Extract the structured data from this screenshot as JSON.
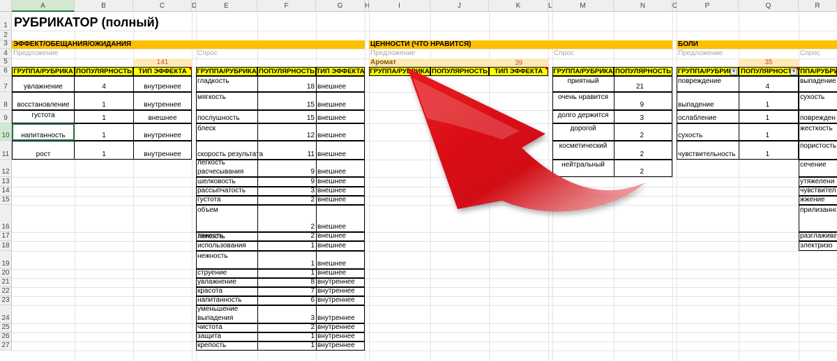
{
  "columns": [
    {
      "id": "A",
      "label": "A",
      "selected": true
    },
    {
      "id": "B",
      "label": "B"
    },
    {
      "id": "C",
      "label": "C"
    },
    {
      "id": "D",
      "label": "D"
    },
    {
      "id": "E",
      "label": "E"
    },
    {
      "id": "F",
      "label": "F"
    },
    {
      "id": "G",
      "label": "G"
    },
    {
      "id": "H",
      "label": "H"
    },
    {
      "id": "I",
      "label": "I"
    },
    {
      "id": "J",
      "label": "J"
    },
    {
      "id": "K",
      "label": "K"
    },
    {
      "id": "L",
      "label": "L"
    },
    {
      "id": "M",
      "label": "M"
    },
    {
      "id": "N",
      "label": "N"
    },
    {
      "id": "O",
      "label": "O"
    },
    {
      "id": "P",
      "label": "P"
    },
    {
      "id": "Q",
      "label": "Q"
    },
    {
      "id": "R",
      "label": "R"
    }
  ],
  "rows": [
    "1",
    "2",
    "3",
    "4",
    "5",
    "6",
    "7",
    "8",
    "9",
    "10",
    "11",
    "12",
    "13",
    "14",
    "15",
    "16",
    "17",
    "18",
    "19",
    "20",
    "21",
    "22",
    "23",
    "24",
    "25",
    "26",
    "27"
  ],
  "selected_row": "10",
  "title": "РУБРИКАТОР (полный)",
  "sections": {
    "effect": "ЭФФЕКТ/ОБЕЩАНИЯ/ОЖИДАНИЯ",
    "values": "ЦЕННОСТИ (ЧТО НРАВИТСЯ)",
    "pains": "БОЛИ"
  },
  "sublabels": {
    "offer1": "Предложение",
    "demand1": "Спрос",
    "offer2": "Предложение",
    "demand2": "Спрос",
    "offer3": "Предложение",
    "demand3": "Спрос"
  },
  "totals": {
    "effect": "141",
    "values": "39",
    "pains": "35"
  },
  "aroma": "Аромат",
  "headers": {
    "group": "ГРУППА/РУБРИКА",
    "popularity": "ПОПУЛЯРНОСТЬ",
    "effect_type": "ТИП ЭФФЕКТА"
  },
  "offer_effect": [
    {
      "group": "увлажнение",
      "pop": "4",
      "type": "внутреннее"
    },
    {
      "group": "восстановление",
      "pop": "1",
      "type": "внутреннее"
    },
    {
      "group": "густота",
      "pop": "1",
      "type": "внешнее"
    },
    {
      "group": "напитанность",
      "pop": "1",
      "type": "внутреннее"
    },
    {
      "group": "рост",
      "pop": "1",
      "type": "внутреннее"
    }
  ],
  "demand_effect": [
    {
      "group": "гладкость",
      "pop": "18",
      "type": "внешнее"
    },
    {
      "group": "мягкость",
      "pop": "15",
      "type": "внешнее"
    },
    {
      "group": "послушность",
      "pop": "15",
      "type": "внешнее"
    },
    {
      "group": "блеск",
      "pop": "12",
      "type": "внешнее"
    },
    {
      "group": "скорость результата",
      "pop": "11",
      "type": "внешнее"
    },
    {
      "group": "легкость",
      "group2": "расчесывания",
      "pop": "9",
      "type": "внешнее"
    },
    {
      "group": "шелковость",
      "pop": "9",
      "type": "внешнее"
    },
    {
      "group": "рассыпчатость",
      "pop": "3",
      "type": "внешнее"
    },
    {
      "group": "густота",
      "pop": "2",
      "type": "внешнее"
    },
    {
      "group": "объем",
      "pop": "2",
      "type": "внешнее"
    },
    {
      "group": "тяжесть",
      "pop": "2",
      "type": "внешнее"
    },
    {
      "group": "легкость",
      "group2": "использования",
      "pop": "1",
      "type": "внешнее"
    },
    {
      "group": "нежность",
      "pop": "1",
      "type": "внешнее"
    },
    {
      "group": "струение",
      "pop": "1",
      "type": "внешнее"
    },
    {
      "group": "увлажнение",
      "pop": "8",
      "type": "внутреннее"
    },
    {
      "group": "красота",
      "pop": "7",
      "type": "внутреннее"
    },
    {
      "group": "напитанность",
      "pop": "6",
      "type": "внутреннее"
    },
    {
      "group": "уменьшение",
      "group2": "выпадения",
      "pop": "3",
      "type": "внутреннее"
    },
    {
      "group": "чистота",
      "pop": "2",
      "type": "внутреннее"
    },
    {
      "group": "защита",
      "pop": "1",
      "type": "внутреннее"
    },
    {
      "group": "крепость",
      "pop": "1",
      "type": "внутреннее"
    }
  ],
  "demand_values": [
    {
      "group": "приятный",
      "pop": "21"
    },
    {
      "group": "очень нравится",
      "pop": "9"
    },
    {
      "group": "долго держится",
      "pop": "3"
    },
    {
      "group": "дорогой",
      "pop": "2"
    },
    {
      "group": "косметический",
      "pop": "2"
    },
    {
      "group": "нейтральный",
      "pop": "2"
    }
  ],
  "offer_pains": [
    {
      "group": "повреждение",
      "pop": "4"
    },
    {
      "group": "выпадение",
      "pop": "1"
    },
    {
      "group": "ослабление",
      "pop": "1"
    },
    {
      "group": "сухость",
      "pop": "1"
    },
    {
      "group": "чувствительность",
      "pop": "1"
    }
  ],
  "demand_pains": [
    "выпадение",
    "сухость",
    "поврежден",
    "жесткость",
    "пористость",
    "сечение",
    "утяжелени",
    "чувствител",
    "жжение",
    "прилизанно",
    "разглажива",
    "электризо"
  ],
  "colors": {
    "orange": "#ffc000",
    "yellow": "#ffff00",
    "peach": "#fde9b8",
    "arrow": "#e8141c"
  }
}
